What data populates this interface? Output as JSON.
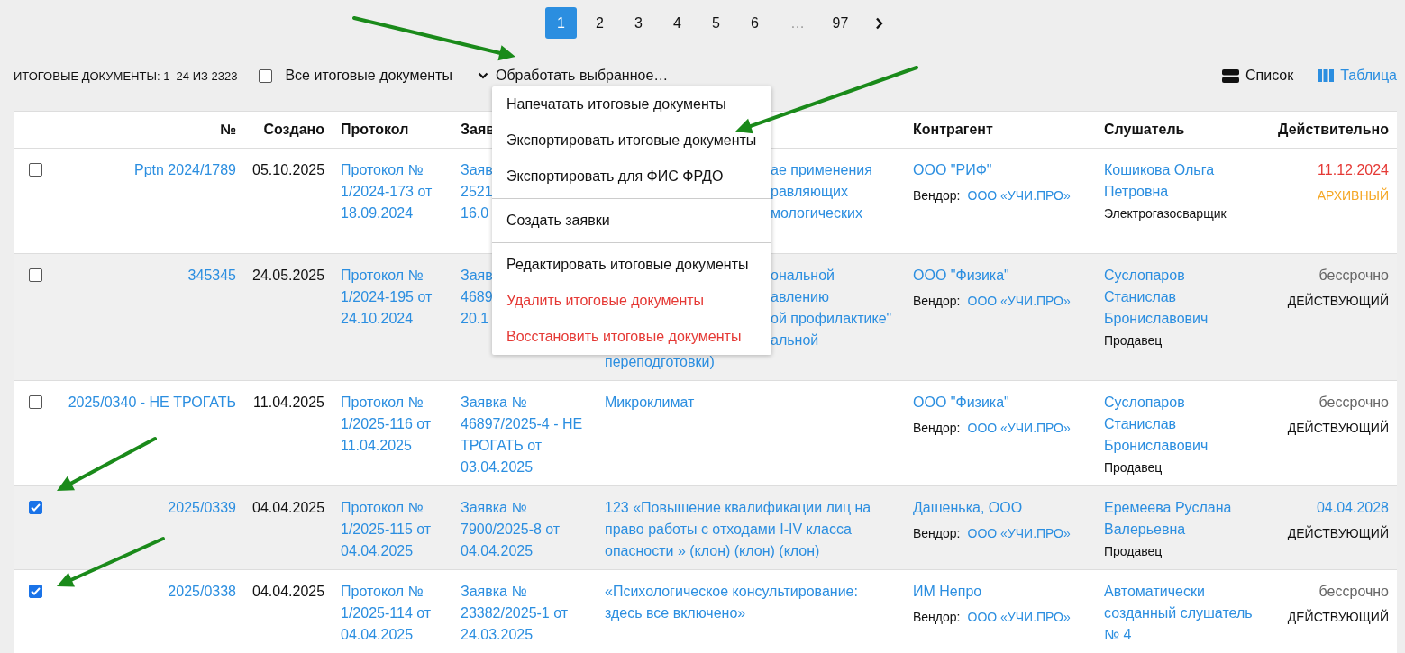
{
  "pagination": {
    "pages": [
      {
        "label": "1",
        "selected": true
      },
      {
        "label": "2",
        "selected": false
      },
      {
        "label": "3",
        "selected": false
      },
      {
        "label": "4",
        "selected": false
      },
      {
        "label": "5",
        "selected": false
      },
      {
        "label": "6",
        "selected": false
      },
      {
        "label": "…",
        "selected": false,
        "kind": "gap"
      },
      {
        "label": "97",
        "selected": false
      }
    ]
  },
  "toolbar": {
    "count": "ИТОГОВЫЕ ДОКУМЕНТЫ: 1–24 ИЗ 2323",
    "select_all": {
      "label": "Все итоговые документы",
      "checked": false
    },
    "actions": {
      "label": "Обработать выбранное…",
      "expanded": true
    },
    "views": [
      {
        "label": "Список",
        "selected": false,
        "kind": "list"
      },
      {
        "label": "Таблица",
        "selected": true,
        "kind": "table"
      }
    ]
  },
  "menu": {
    "groups": [
      [
        {
          "label": "Напечатать итоговые документы",
          "danger": false
        },
        {
          "label": "Экспортировать итоговые документы",
          "danger": false
        },
        {
          "label": "Экспортировать для ФИС ФРДО",
          "danger": false
        }
      ],
      [
        {
          "label": "Создать заявки",
          "danger": false
        }
      ],
      [
        {
          "label": "Редактировать итоговые документы",
          "danger": false
        },
        {
          "label": "Удалить итоговые документы",
          "danger": true
        },
        {
          "label": "Восстановить итоговые документы",
          "danger": true
        }
      ]
    ]
  },
  "table": {
    "columns": [
      "№",
      "Создано",
      "Протокол",
      "Заяв",
      "Контрагент",
      "Слушатель",
      "Действительно"
    ],
    "rows": [
      {
        "checked": false,
        "number": "Pptn 2024/1789",
        "created": "05.10.2025",
        "protocol": "Протокол № 1/2024-173 от 18.09.2024",
        "application": [
          "Заяв",
          "2521",
          "16.0"
        ],
        "course": [
          {
            "text": "ае применения",
            "covered": true
          },
          {
            "text": "равляющих",
            "covered": true
          },
          {
            "text": "мологических",
            "covered": true
          }
        ],
        "contractor": "ООО \"РИФ\"",
        "vendor_label": "Вендор:",
        "vendor": "ООО «УЧИ.ПРО»",
        "listener": "Кошикова Ольга Петровна",
        "position": "Электрогазосварщик",
        "valid": {
          "text": "11.12.2024",
          "kind": "expired"
        },
        "status": {
          "text": "АРХИВНЫЙ",
          "kind": "archived"
        }
      },
      {
        "checked": false,
        "number": "345345",
        "created": "24.05.2025",
        "protocol": "Протокол № 1/2024-195 от 24.10.2024",
        "application": [
          "Заяв",
          "4689",
          "20.1"
        ],
        "course": [
          {
            "text": "ональной",
            "covered": true
          },
          {
            "text": "авлению",
            "covered": true
          },
          {
            "text": "ой профилактике\"",
            "covered": true
          },
          {
            "text": "альной",
            "covered": true
          },
          {
            "text": "переподготовки)",
            "covered": false
          }
        ],
        "contractor": "ООО \"Физика\"",
        "vendor_label": "Вендор:",
        "vendor": "ООО «УЧИ.ПРО»",
        "listener": "Суслопаров Станислав Брониславович",
        "position": "Продавец",
        "valid": {
          "text": "бессрочно",
          "kind": "unlimited"
        },
        "status": {
          "text": "ДЕЙСТВУЮЩИЙ",
          "kind": "active"
        }
      },
      {
        "checked": false,
        "number": "2025/0340 - НЕ ТРОГАТЬ",
        "created": "11.04.2025",
        "protocol": "Протокол № 1/2025-116 от 11.04.2025",
        "application": "Заявка № 46897/2025-4 - НЕ ТРОГАТЬ от 03.04.2025",
        "course": "Микроклимат",
        "contractor": "ООО \"Физика\"",
        "vendor_label": "Вендор:",
        "vendor": "ООО «УЧИ.ПРО»",
        "listener": "Суслопаров Станислав Брониславович",
        "position": "Продавец",
        "valid": {
          "text": "бессрочно",
          "kind": "unlimited"
        },
        "status": {
          "text": "ДЕЙСТВУЮЩИЙ",
          "kind": "active"
        }
      },
      {
        "checked": true,
        "number": "2025/0339",
        "created": "04.04.2025",
        "protocol": "Протокол № 1/2025-115 от 04.04.2025",
        "application": "Заявка № 7900/2025-8 от 04.04.2025",
        "course": "123 «Повышение квалификации лиц на право работы с отходами I-IV класса опасности » (клон) (клон) (клон)",
        "contractor": "Дашенька, ООО",
        "vendor_label": "Вендор:",
        "vendor": "ООО «УЧИ.ПРО»",
        "listener": "Еремеева Руслана Валерьевна",
        "position": "Продавец",
        "valid": {
          "text": "04.04.2028",
          "kind": "date"
        },
        "status": {
          "text": "ДЕЙСТВУЮЩИЙ",
          "kind": "active"
        }
      },
      {
        "checked": true,
        "number": "2025/0338",
        "created": "04.04.2025",
        "protocol": "Протокол № 1/2025-114 от 04.04.2025",
        "application": "Заявка № 23382/2025-1 от 24.03.2025",
        "course": "«Психологическое консультирование: здесь все включено»",
        "contractor": "ИМ Непро",
        "vendor_label": "Вендор:",
        "vendor": "ООО «УЧИ.ПРО»",
        "listener": "Автоматически созданный слушатель № 4",
        "valid": {
          "text": "бессрочно",
          "kind": "unlimited"
        },
        "status": {
          "text": "ДЕЙСТВУЮЩИЙ",
          "kind": "active"
        }
      }
    ]
  }
}
